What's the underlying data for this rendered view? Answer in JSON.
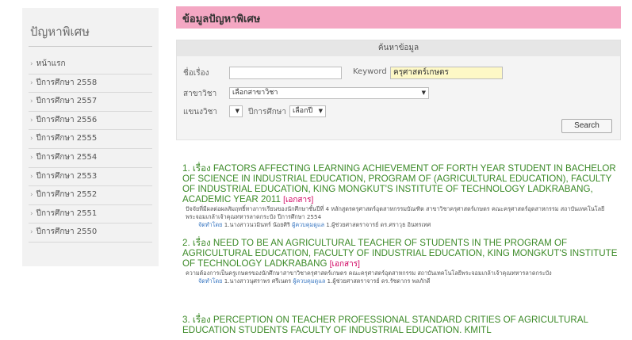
{
  "sidebar": {
    "title": "ปัญหาพิเศษ",
    "items": [
      {
        "label": "หน้าแรก"
      },
      {
        "label": "ปีการศึกษา 2558"
      },
      {
        "label": "ปีการศึกษา 2557"
      },
      {
        "label": "ปีการศึกษา 2556"
      },
      {
        "label": "ปีการศึกษา 2555"
      },
      {
        "label": "ปีการศึกษา 2554"
      },
      {
        "label": "ปีการศึกษา 2553"
      },
      {
        "label": "ปีการศึกษา 2552"
      },
      {
        "label": "ปีการศึกษา 2551"
      },
      {
        "label": "ปีการศึกษา 2550"
      }
    ]
  },
  "main": {
    "title": "ข้อมูลปัญหาพิเศษ"
  },
  "search": {
    "heading": "ค้นหาข้อมูล",
    "subject_label": "ชื่อเรื่อง",
    "subject_value": "",
    "keyword_label": "Keyword",
    "keyword_value": "ครุศาสตร์เกษตร",
    "major_label": "สาขาวิชา",
    "major_value": "เลือกสาขาวิชา",
    "type_label": "แขนงวิชา",
    "type_value": "",
    "year_label": "ปีการศึกษา",
    "year_value": "เลือกปี",
    "button_label": "Search"
  },
  "results": [
    {
      "title": "1. เรื่อง FACTORS AFFECTING LEARNING ACHIEVEMENT OF FORTH YEAR STUDENT IN BACHELOR OF SCIENCE IN INDUSTRIAL EDUCATION, PROGRAM OF (AGRICULTURAL EDUCATION), FACULTY OF INDUSTRIAL EDUCATION, KING MONGKUT'S INSTITUTE OF TECHNOLOGY LADKRABANG, ACADEMIC YEAR 2011",
      "doc_label": "[เอกสาร]",
      "desc": "ปัจจัยที่มีผลต่อผลสัมฤทธิ์ทางการเรียนของนักศึกษาชั้นปีที่ 4 หลักสูตรครุศาสตร์อุตสาหกรรมบัณฑิต สาขาวิชาครุศาสตร์เกษตร คณะครุศาสตร์อุตสาหกรรม สถาบันเทคโนโลยีพระจอมเกล้าเจ้าคุณทหารลาดกระบัง ปีการศึกษา 2554",
      "by_label": "จัดทำโดย",
      "by_value": "1.นางสาวนวมินทร์ น้อยศิริ",
      "advisor_label": "ผู้ควบคุมดูแล",
      "advisor_value": "1.ผู้ช่วยศาสตราจารย์ ดร.ศราวุธ อินทรเทศ"
    },
    {
      "title": "2. เรื่อง NEED TO BE AN AGRICULTURAL TEACHER OF STUDENTS IN THE PROGRAM OF AGRICULTURAL EDUCATION, FACULTY OF INDUSTRIAL EDUCATION, KING MONGKUT'S INSTITUTE OF TECHNOLOGY LADKRABANG",
      "doc_label": "[เอกสาร]",
      "desc": "ความต้องการเป็นครูเกษตรของนักศึกษาสาขาวิชาครุศาสตร์เกษตร คณะครุศาสตร์อุตสาหกรรม สถาบันเทคโนโลยีพระจอมเกล้าเจ้าคุณทหารลาดกระบัง",
      "by_label": "จัดทำโดย",
      "by_value": "1.นางสาวนุศราพร ศรีเนตร",
      "advisor_label": "ผู้ควบคุมดูแล",
      "advisor_value": "1.ผู้ช่วยศาสตราจารย์ ดร.รัชดากร พลภักดี"
    },
    {
      "title": "3. เรื่อง PERCEPTION ON TEACHER PROFESSIONAL STANDARD CRITIES OF AGRICULTURAL EDUCATION STUDENTS FACULTY OF INDUSTRIAL EDUCATION. KMITL"
    }
  ],
  "colors": {
    "header_pink": "#f4a7c3",
    "result_green": "#3c8a28",
    "doc_pink": "#d0005f",
    "meta_blue": "#3a78c2",
    "keyword_yellow": "#fdf8c6"
  }
}
